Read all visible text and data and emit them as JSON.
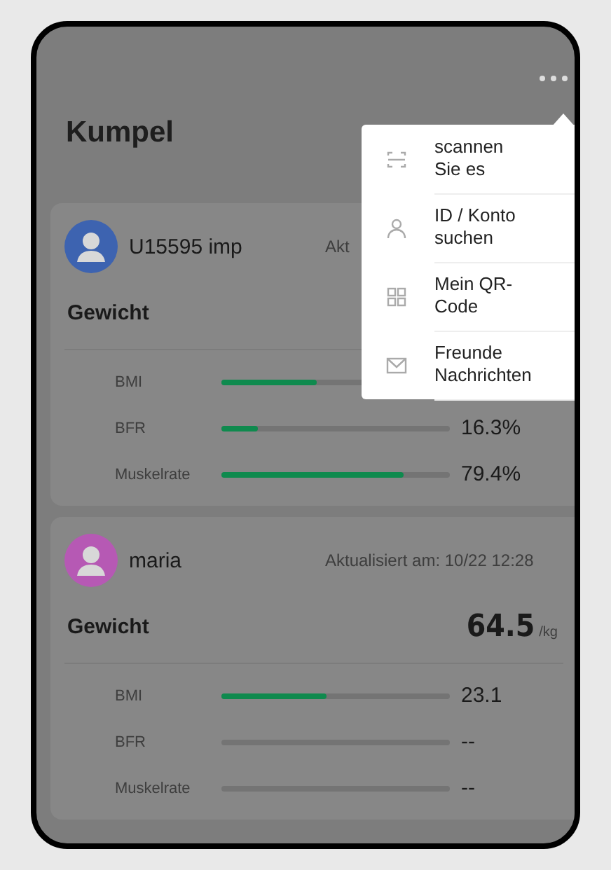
{
  "header": {
    "title": "Kumpel"
  },
  "menu": {
    "items": [
      {
        "kind": "scan",
        "label": "scannen\nSie es"
      },
      {
        "kind": "person",
        "label": "ID / Konto\nsuchen"
      },
      {
        "kind": "qr",
        "label": "Mein QR-\nCode"
      },
      {
        "kind": "mail",
        "label": "Freunde\nNachrichten"
      }
    ]
  },
  "friends": [
    {
      "name": "U15595 imp",
      "color": "#3d63b0",
      "updated": "Akt",
      "weight_label": "Gewicht",
      "metrics": [
        {
          "label": "BMI",
          "level": 0.42
        },
        {
          "label": "BFR",
          "level": 0.16,
          "value": "16.3%"
        },
        {
          "label": "Muskelrate",
          "level": 0.8,
          "value": "79.4%"
        }
      ]
    },
    {
      "name": "maria",
      "color": "#b659b4",
      "updated": "Aktualisiert am: 10/22 12:28",
      "weight_label": "Gewicht",
      "weight": "64.5",
      "unit": "/kg",
      "metrics": [
        {
          "label": "BMI",
          "level": 0.46,
          "value": "23.1"
        },
        {
          "label": "BFR",
          "value": "--"
        },
        {
          "label": "Muskelrate",
          "value": "--"
        }
      ]
    }
  ]
}
